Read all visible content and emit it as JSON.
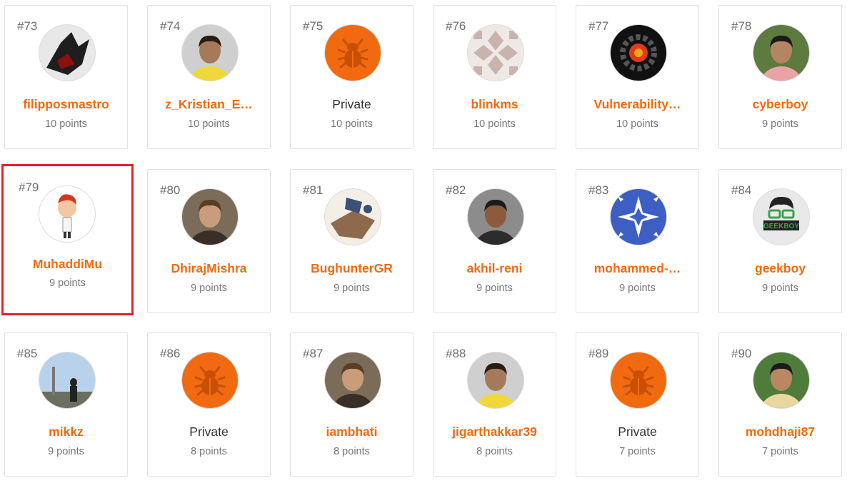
{
  "leaderboard": {
    "entries": [
      {
        "rank": "#73",
        "name": "filipposmastro",
        "points": "10 points",
        "private": false,
        "avatar": "avatar-dark-figure"
      },
      {
        "rank": "#74",
        "name": "z_Kristian_E…",
        "points": "10 points",
        "private": false,
        "avatar": "avatar-photo-man"
      },
      {
        "rank": "#75",
        "name": "Private",
        "points": "10 points",
        "private": true,
        "avatar": "bug-icon"
      },
      {
        "rank": "#76",
        "name": "blinkms",
        "points": "10 points",
        "private": false,
        "avatar": "avatar-pattern"
      },
      {
        "rank": "#77",
        "name": "Vulnerability…",
        "points": "10 points",
        "private": false,
        "avatar": "avatar-gear"
      },
      {
        "rank": "#78",
        "name": "cyberboy",
        "points": "9 points",
        "private": false,
        "avatar": "avatar-photo-man"
      },
      {
        "rank": "#79",
        "name": "MuhaddiMu",
        "points": "9 points",
        "private": false,
        "avatar": "avatar-cartoon",
        "highlighted": true
      },
      {
        "rank": "#80",
        "name": "DhirajMishra",
        "points": "9 points",
        "private": false,
        "avatar": "avatar-photo-man"
      },
      {
        "rank": "#81",
        "name": "BughunterGR",
        "points": "9 points",
        "private": false,
        "avatar": "avatar-illustration"
      },
      {
        "rank": "#82",
        "name": "akhil-reni",
        "points": "9 points",
        "private": false,
        "avatar": "avatar-photo-man"
      },
      {
        "rank": "#83",
        "name": "mohammed-…",
        "points": "9 points",
        "private": false,
        "avatar": "avatar-pattern-blue"
      },
      {
        "rank": "#84",
        "name": "geekboy",
        "points": "9 points",
        "private": false,
        "avatar": "avatar-geekboy-logo"
      },
      {
        "rank": "#85",
        "name": "mikkz",
        "points": "9 points",
        "private": false,
        "avatar": "avatar-photo-landscape"
      },
      {
        "rank": "#86",
        "name": "Private",
        "points": "8 points",
        "private": true,
        "avatar": "bug-icon"
      },
      {
        "rank": "#87",
        "name": "iambhati",
        "points": "8 points",
        "private": false,
        "avatar": "avatar-photo-man"
      },
      {
        "rank": "#88",
        "name": "jigarthakkar39",
        "points": "8 points",
        "private": false,
        "avatar": "avatar-photo-man"
      },
      {
        "rank": "#89",
        "name": "Private",
        "points": "7 points",
        "private": true,
        "avatar": "bug-icon"
      },
      {
        "rank": "#90",
        "name": "mohdhaji87",
        "points": "7 points",
        "private": false,
        "avatar": "avatar-photo-man"
      }
    ],
    "colors": {
      "name_accent": "#f26a10",
      "private_avatar_bg": "#f26a10",
      "highlight_border": "#e3212b"
    },
    "geekboy_logo_text": "GEEKBOY"
  }
}
